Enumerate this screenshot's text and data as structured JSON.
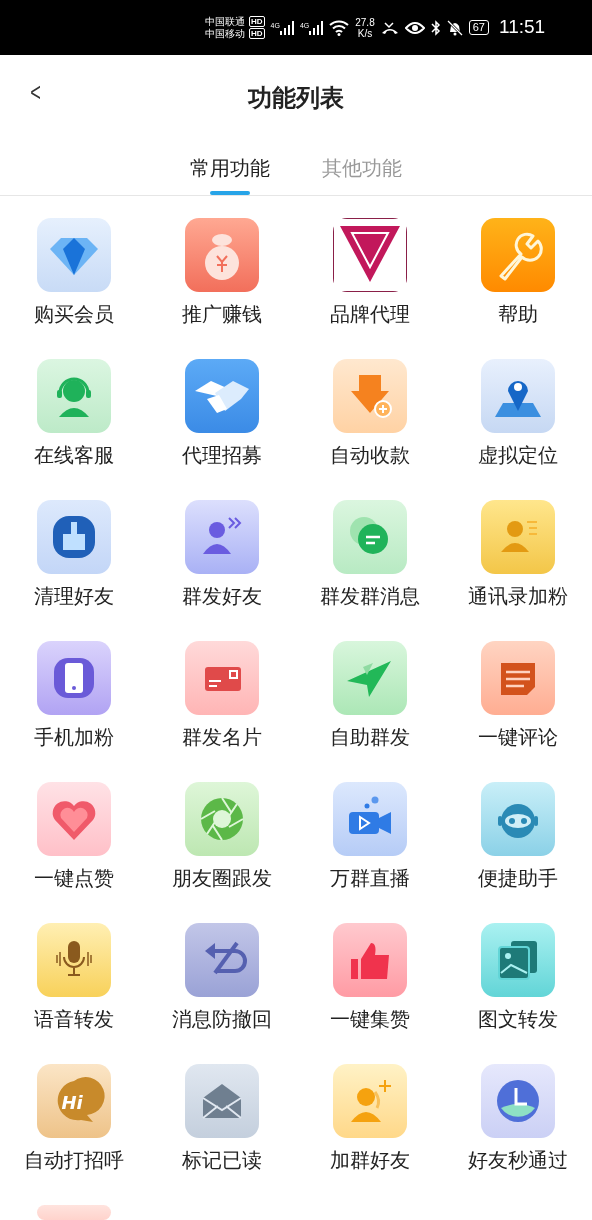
{
  "status_bar": {
    "carrier_1": "中国联通",
    "carrier_1_badge": "HD",
    "carrier_2": "中国移动",
    "carrier_2_badge": "HD",
    "network_1": "4G",
    "network_2": "4G",
    "speed": "27.8",
    "speed_unit": "K/s",
    "battery": "67",
    "time": "11:51"
  },
  "header": {
    "back": "<",
    "title": "功能列表"
  },
  "tabs": [
    {
      "label": "常用功能",
      "selected": true
    },
    {
      "label": "其他功能",
      "selected": false
    }
  ],
  "features": [
    {
      "label": "购买会员"
    },
    {
      "label": "推广赚钱"
    },
    {
      "label": "品牌代理"
    },
    {
      "label": "帮助"
    },
    {
      "label": "在线客服"
    },
    {
      "label": "代理招募"
    },
    {
      "label": "自动收款"
    },
    {
      "label": "虚拟定位"
    },
    {
      "label": "清理好友"
    },
    {
      "label": "群发好友"
    },
    {
      "label": "群发群消息"
    },
    {
      "label": "通讯录加粉"
    },
    {
      "label": "手机加粉"
    },
    {
      "label": "群发名片"
    },
    {
      "label": "自助群发"
    },
    {
      "label": "一键评论"
    },
    {
      "label": "一键点赞"
    },
    {
      "label": "朋友圈跟发"
    },
    {
      "label": "万群直播"
    },
    {
      "label": "便捷助手"
    },
    {
      "label": "语音转发"
    },
    {
      "label": "消息防撤回"
    },
    {
      "label": "一键集赞"
    },
    {
      "label": "图文转发"
    },
    {
      "label": "自动打招呼",
      "icon_text": "Hi"
    },
    {
      "label": "标记已读"
    },
    {
      "label": "加群好友"
    },
    {
      "label": "好友秒通过"
    },
    {
      "kind": "cut_off"
    }
  ]
}
